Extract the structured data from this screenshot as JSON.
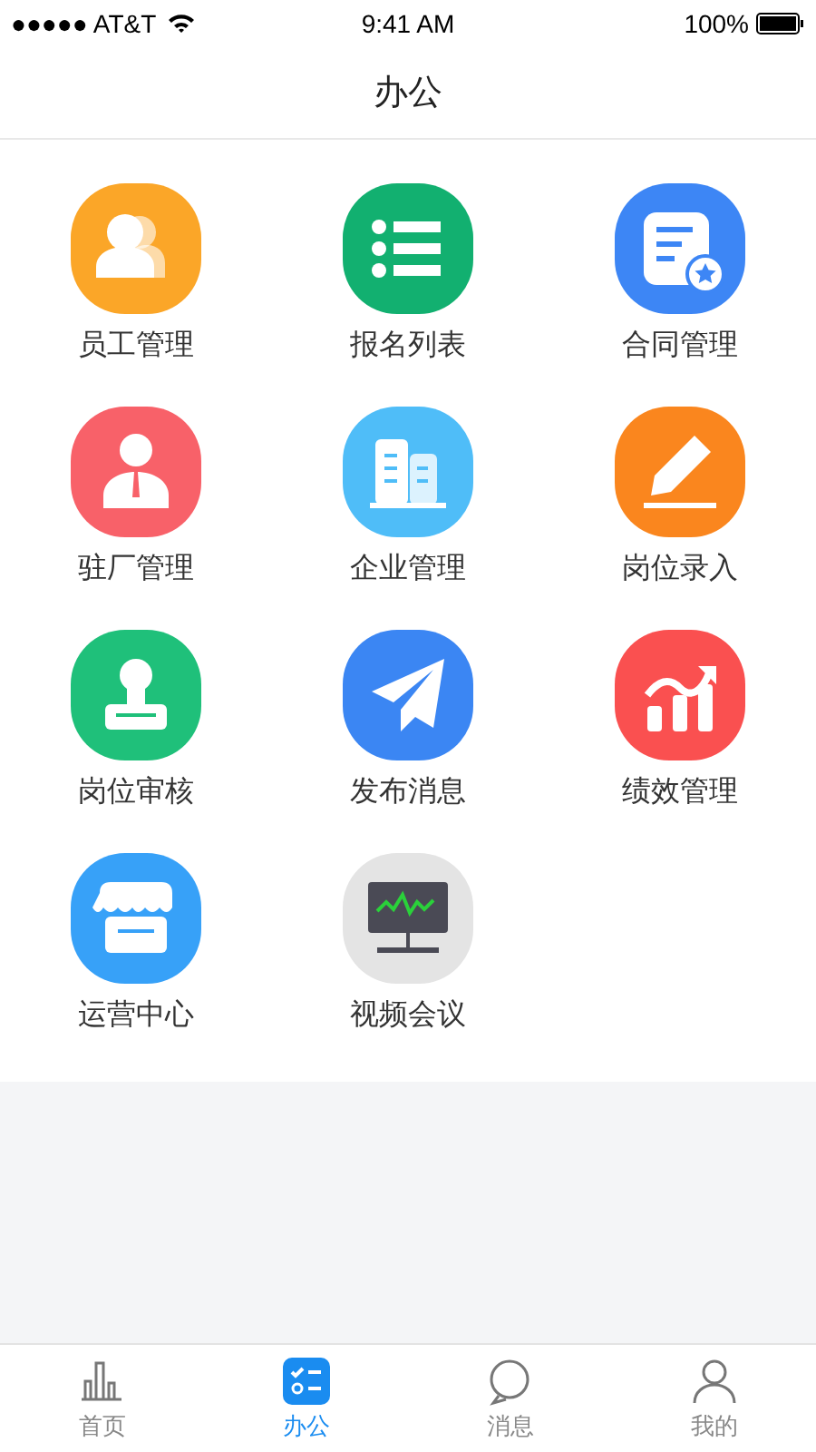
{
  "status_bar": {
    "carrier": "●●●●● AT&T",
    "time": "9:41 AM",
    "battery": "100%"
  },
  "nav_bar": {
    "title": "办公"
  },
  "apps": [
    {
      "label": "员工管理",
      "kind": "people",
      "color": "#fba628"
    },
    {
      "label": "报名列表",
      "kind": "list",
      "color": "#12b070"
    },
    {
      "label": "合同管理",
      "kind": "contract",
      "color": "#3d86f5"
    },
    {
      "label": "驻厂管理",
      "kind": "person",
      "color": "#f86169"
    },
    {
      "label": "企业管理",
      "kind": "building",
      "color": "#4fbdf8"
    },
    {
      "label": "岗位录入",
      "kind": "pencil",
      "color": "#fa861e"
    },
    {
      "label": "岗位审核",
      "kind": "stamp",
      "color": "#1fc07a"
    },
    {
      "label": "发布消息",
      "kind": "plane",
      "color": "#3b86f3"
    },
    {
      "label": "绩效管理",
      "kind": "chart",
      "color": "#fa5050"
    },
    {
      "label": "运营中心",
      "kind": "store",
      "color": "#37a1f8"
    },
    {
      "label": "视频会议",
      "kind": "monitor",
      "color": "#e4e4e4"
    }
  ],
  "tab_bar": [
    {
      "label": "首页",
      "kind": "bars",
      "selected": false
    },
    {
      "label": "办公",
      "kind": "tasks",
      "selected": true
    },
    {
      "label": "消息",
      "kind": "bubble",
      "selected": false
    },
    {
      "label": "我的",
      "kind": "user",
      "selected": false
    }
  ]
}
